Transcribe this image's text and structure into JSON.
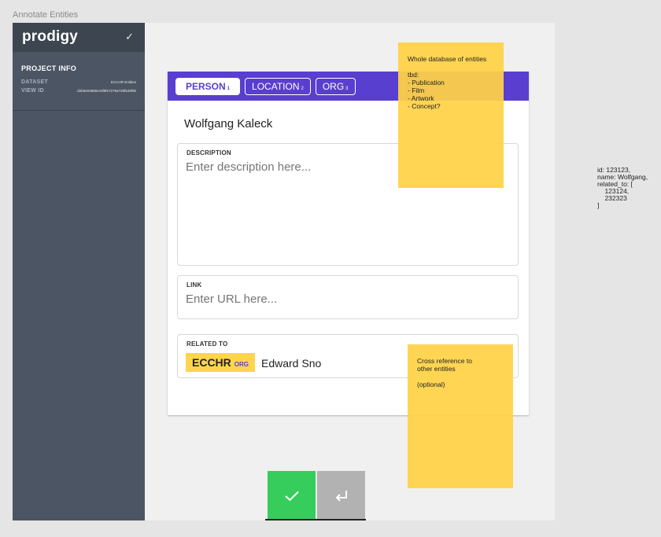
{
  "frame_title": "Annotate Entities",
  "sidebar": {
    "logo": "prodigy",
    "project_info_title": "PROJECT INFO",
    "rows": [
      {
        "key": "DATASET",
        "value": "ECCHR Entities"
      },
      {
        "key": "VIEW ID",
        "value": "d2b6e03886ec5f9fe7279a729f549f0b"
      }
    ]
  },
  "labels": [
    {
      "name": "PERSON",
      "key": "1"
    },
    {
      "name": "LOCATION",
      "key": "2"
    },
    {
      "name": "ORG",
      "key": "3"
    }
  ],
  "entity_name": "Wolfgang Kaleck",
  "description": {
    "label": "DESCRIPTION",
    "placeholder": "Enter description here..."
  },
  "link": {
    "label": "LINK",
    "placeholder": "Enter URL here..."
  },
  "related": {
    "label": "RELATED TO",
    "chip_entity": "ECCHR",
    "chip_type": "ORG",
    "typed_text": "Edward Sno"
  },
  "sticky_top": {
    "line1": "Whole database of entities",
    "line2": "tbd:",
    "items": [
      "- Publication",
      "- Film",
      "- Artwork",
      "- Concept?"
    ]
  },
  "sticky_bottom": {
    "line1": "Cross reference to",
    "line2": "other entities",
    "line3": "(optional)"
  },
  "side_note": [
    "id: 123123,",
    "name: Wolfgang,",
    "related_to: [",
    "    123124,",
    "    232323",
    "]"
  ],
  "colors": {
    "accent": "#583fcf",
    "accept": "#37cd5c",
    "sticky": "#ffd54f",
    "sidebar": "#4b5563"
  }
}
